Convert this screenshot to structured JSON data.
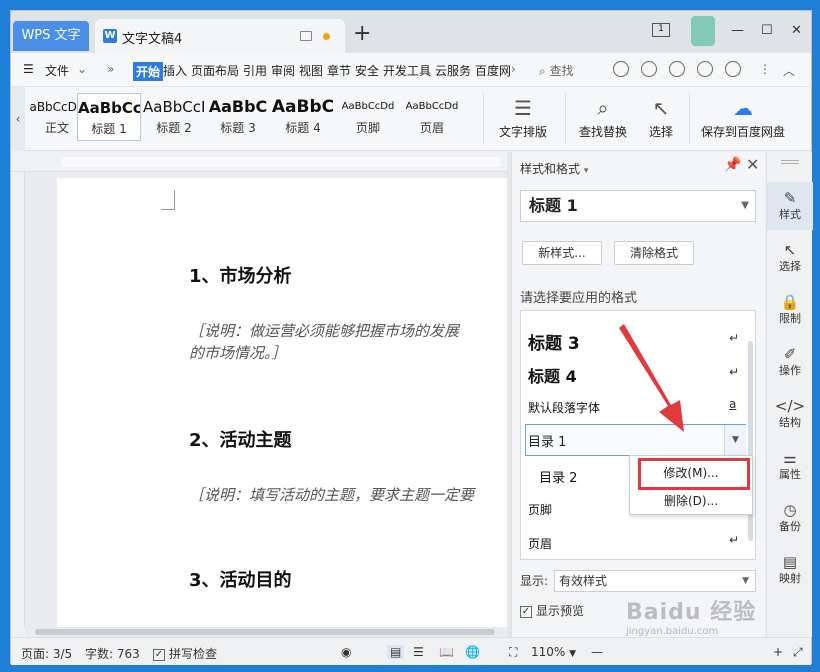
{
  "titlebar": {
    "app_tab": "WPS 文字",
    "doc_tab": "文字文稿4",
    "new_tab": "+",
    "page_indicator": "1",
    "minimize": "—",
    "maximize": "☐",
    "close": "✕"
  },
  "menubar": {
    "file": "文件",
    "tabs": [
      "开始",
      "插入",
      "页面布局",
      "引用",
      "审阅",
      "视图",
      "章节",
      "安全",
      "开发工具",
      "云服务",
      "百度网"
    ],
    "search": "查找"
  },
  "ribbon": {
    "styles": [
      {
        "sample": "aBbCcDd",
        "name": "正文"
      },
      {
        "sample": "AaBbCcI",
        "name": "标题 1"
      },
      {
        "sample": "AaBbCcI",
        "name": "标题 2"
      },
      {
        "sample": "AaBbC",
        "name": "标题 3"
      },
      {
        "sample": "AaBbC",
        "name": "标题 4"
      },
      {
        "sample": "AaBbCcDd",
        "name": "页脚"
      },
      {
        "sample": "AaBbCcDd",
        "name": "页眉"
      }
    ],
    "tools": [
      {
        "icon": "text-layout-icon",
        "label": "文字排版"
      },
      {
        "icon": "find-replace-icon",
        "label": "查找替换"
      },
      {
        "icon": "select-icon",
        "label": "选择"
      },
      {
        "icon": "baidu-cloud-icon",
        "label": "保存到百度网盘"
      }
    ]
  },
  "document": {
    "headings": [
      "1、市场分析",
      "2、活动主题",
      "3、活动目的"
    ],
    "notes": [
      [
        "［说明：做运营必须能够把握市场的发展",
        "的市场情况。］"
      ],
      [
        "［说明：填写活动的主题，要求主题一定要"
      ]
    ]
  },
  "panel": {
    "title": "样式和格式",
    "current_style": "标题  1",
    "new_style_btn": "新样式...",
    "clear_format_btn": "清除格式",
    "apply_label": "请选择要应用的格式",
    "styles": [
      {
        "name": "标题  3",
        "mark": "↵"
      },
      {
        "name": "标题  4",
        "mark": "↵"
      },
      {
        "name": "默认段落字体",
        "mark": "a"
      },
      {
        "name": "目录  1",
        "mark": ""
      },
      {
        "name": "目录  2",
        "mark": ""
      },
      {
        "name": "页脚",
        "mark": ""
      },
      {
        "name": "页眉",
        "mark": "↵"
      }
    ],
    "context_menu": [
      "修改(M)...",
      "删除(D)..."
    ],
    "show_label": "显示:",
    "show_value": "有效样式",
    "preview_label": "显示预览"
  },
  "sidebar": [
    {
      "icon": "style-brush-icon",
      "label": "样式"
    },
    {
      "icon": "cursor-icon",
      "label": "选择"
    },
    {
      "icon": "lock-icon",
      "label": "限制"
    },
    {
      "icon": "edit-icon",
      "label": "操作"
    },
    {
      "icon": "code-icon",
      "label": "结构"
    },
    {
      "icon": "sliders-icon",
      "label": "属性"
    },
    {
      "icon": "history-icon",
      "label": "备份"
    },
    {
      "icon": "map-icon",
      "label": "映射"
    }
  ],
  "status": {
    "page": "页面: 3/5",
    "words": "字数: 763",
    "spellcheck": "拼写检查",
    "zoom": "110%"
  },
  "watermark": {
    "text": "Baidu 经验",
    "sub": "jingyan.baidu.com"
  },
  "colors": {
    "accent": "#2f7be4",
    "highlight": "#e0393e",
    "titlebar": "#dfe3e8"
  }
}
